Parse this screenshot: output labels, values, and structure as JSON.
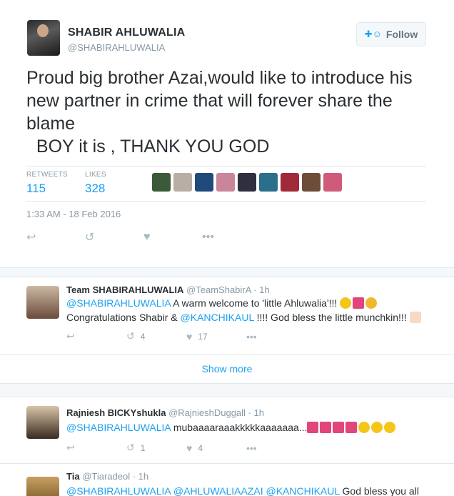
{
  "main_tweet": {
    "author_name": "SHABIR AHLUWALIA",
    "author_handle": "@SHABIRAHLUWALIA",
    "follow_label": "Follow",
    "text": "Proud big brother Azai,would like to introduce his new partner in crime that will forever share the blame\n  BOY it is , THANK YOU GOD",
    "retweets_label": "RETWEETS",
    "retweets_count": "115",
    "likes_label": "LIKES",
    "likes_count": "328",
    "timestamp": "1:33 AM - 18 Feb 2016",
    "liker_colors": [
      "#3c5a3a",
      "#b8aea4",
      "#1f4a7a",
      "#c9869a",
      "#2f2f3f",
      "#2b6f8a",
      "#a02a3a",
      "#6d4c3a",
      "#d05a7a"
    ]
  },
  "replies": [
    {
      "name": "Team SHABIRAHLUWALIA",
      "handle": "@TeamShabirA",
      "time": "· 1h",
      "mention1": "@SHABIRAHLUWALIA",
      "text1": " A warm welcome to 'little Ahluwalia'!!! ",
      "text2_pre": "Congratulations Shabir & ",
      "mention2": "@KANCHIKAUL",
      "text2_post": " !!!! God bless the little munchkin!!! ",
      "retweets": "4",
      "likes": "17"
    },
    {
      "name": "Rajniesh BICKYshukla",
      "handle": "@RajnieshDuggall",
      "time": "· 1h",
      "mention1": "@SHABIRAHLUWALIA",
      "text1": " mubaaaaraaakkkkkaaaaaaa...",
      "retweets": "1",
      "likes": "4"
    },
    {
      "name": "Tia",
      "handle": "@Tiaradeol",
      "time": "· 1h",
      "mention1": "@SHABIRAHLUWALIA",
      "mention2": "@AHLUWALIAAZAI",
      "mention3": "@KANCHIKAUL",
      "text1": " God bless you all"
    }
  ],
  "show_more_label": "Show more"
}
